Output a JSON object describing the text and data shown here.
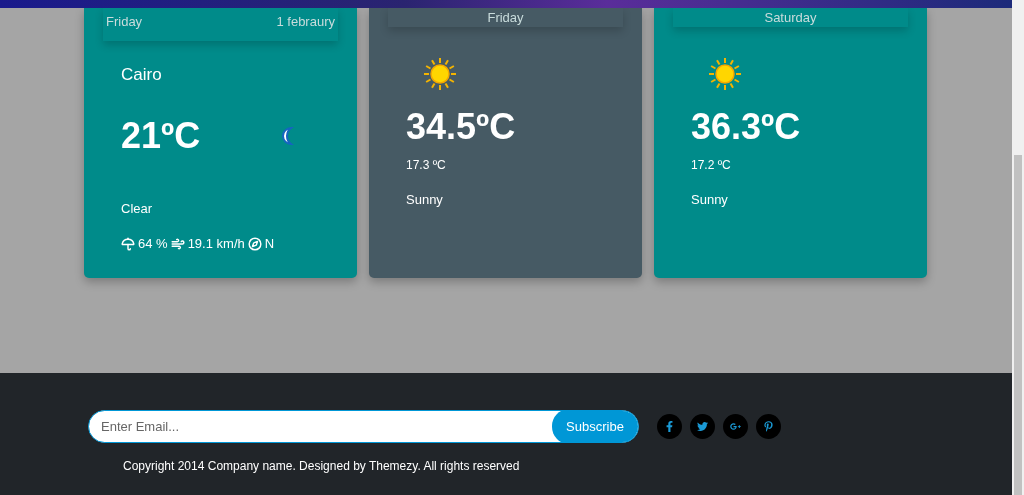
{
  "forecast": [
    {
      "kind": "today",
      "selected": false,
      "day": "Friday",
      "date": "1 febraury",
      "city": "Cairo",
      "temp": "21ºC",
      "condition": "Clear",
      "humidity": "64 %",
      "wind": "19.1 km/h",
      "direction": "N"
    },
    {
      "kind": "day",
      "selected": true,
      "day": "Friday",
      "temp": "34.5ºC",
      "low": "17.3 ºC",
      "condition": "Sunny"
    },
    {
      "kind": "day",
      "selected": false,
      "day": "Saturday",
      "temp": "36.3ºC",
      "low": "17.2 ºC",
      "condition": "Sunny"
    }
  ],
  "footer": {
    "email": {
      "placeholder": "Enter Email..."
    },
    "subscribe": "Subscribe",
    "copyright": "Copyright 2014 Company name. Designed by Themezy. All rights reserved"
  }
}
